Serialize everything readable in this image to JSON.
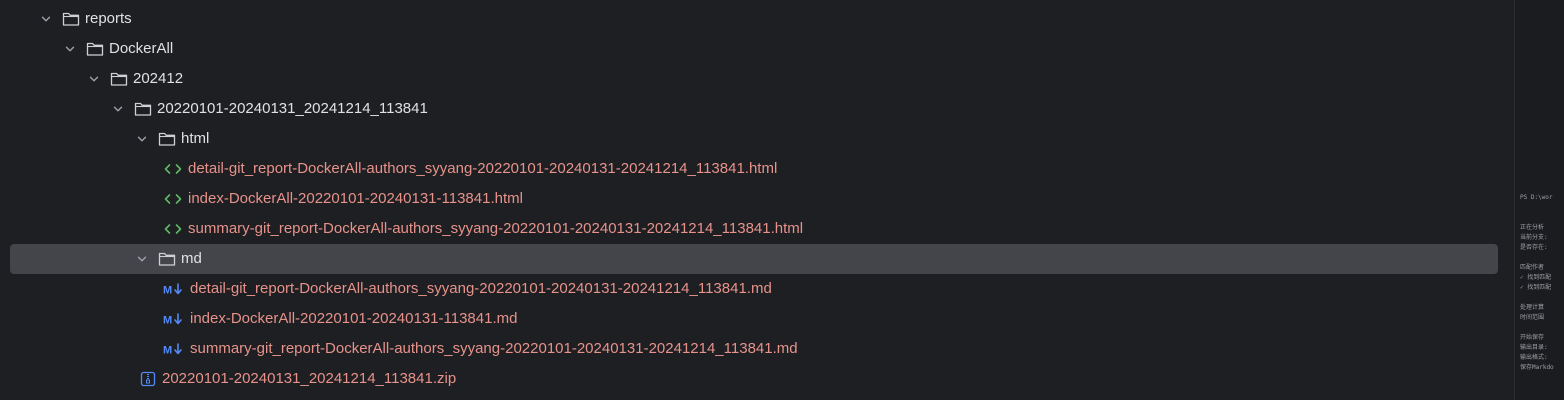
{
  "tree": {
    "nodes": [
      {
        "label": "reports",
        "kind": "folder",
        "depth": 0,
        "expanded": true
      },
      {
        "label": "DockerAll",
        "kind": "folder",
        "depth": 1,
        "expanded": true
      },
      {
        "label": "202412",
        "kind": "folder",
        "depth": 2,
        "expanded": true
      },
      {
        "label": "20220101-20240131_20241214_113841",
        "kind": "folder",
        "depth": 3,
        "expanded": true
      },
      {
        "label": "html",
        "kind": "folder",
        "depth": 4,
        "expanded": true
      },
      {
        "label": "detail-git_report-DockerAll-authors_syyang-20220101-20240131-20241214_113841.html",
        "kind": "html",
        "depth": 5
      },
      {
        "label": "index-DockerAll-20220101-20240131-113841.html",
        "kind": "html",
        "depth": 5
      },
      {
        "label": "summary-git_report-DockerAll-authors_syyang-20220101-20240131-20241214_113841.html",
        "kind": "html",
        "depth": 5
      },
      {
        "label": "md",
        "kind": "folder",
        "depth": 4,
        "expanded": true,
        "selected": true
      },
      {
        "label": "detail-git_report-DockerAll-authors_syyang-20220101-20240131-20241214_113841.md",
        "kind": "md",
        "depth": 5
      },
      {
        "label": "index-DockerAll-20220101-20240131-113841.md",
        "kind": "md",
        "depth": 5
      },
      {
        "label": "summary-git_report-DockerAll-authors_syyang-20220101-20240131-20241214_113841.md",
        "kind": "md",
        "depth": 5
      },
      {
        "label": "20220101-20240131_20241214_113841.zip",
        "kind": "zip",
        "depth": 4
      }
    ]
  },
  "terminal": {
    "lines": [
      "PS D:\\wor",
      "",
      "",
      "正在分析",
      "当前分支:",
      "是否存在:",
      "",
      "匹配作者",
      "✓ 找到匹配",
      "✓ 找到匹配",
      "",
      "处理计算",
      "时间范围",
      "",
      "开始保存",
      "输出目录:",
      "输出格式:",
      "保存Markdo"
    ]
  },
  "colors": {
    "background": "#1e1f22",
    "selected_row": "#43454a",
    "file_text": "#e7928b",
    "folder_text": "#dfe1e5",
    "html_icon": "#5fb865",
    "md_icon": "#548af7"
  },
  "icons": {
    "folder": "folder-icon",
    "html": "html-file-icon",
    "md": "markdown-file-icon",
    "zip": "archive-file-icon",
    "expanded": "chevron-down-icon"
  }
}
